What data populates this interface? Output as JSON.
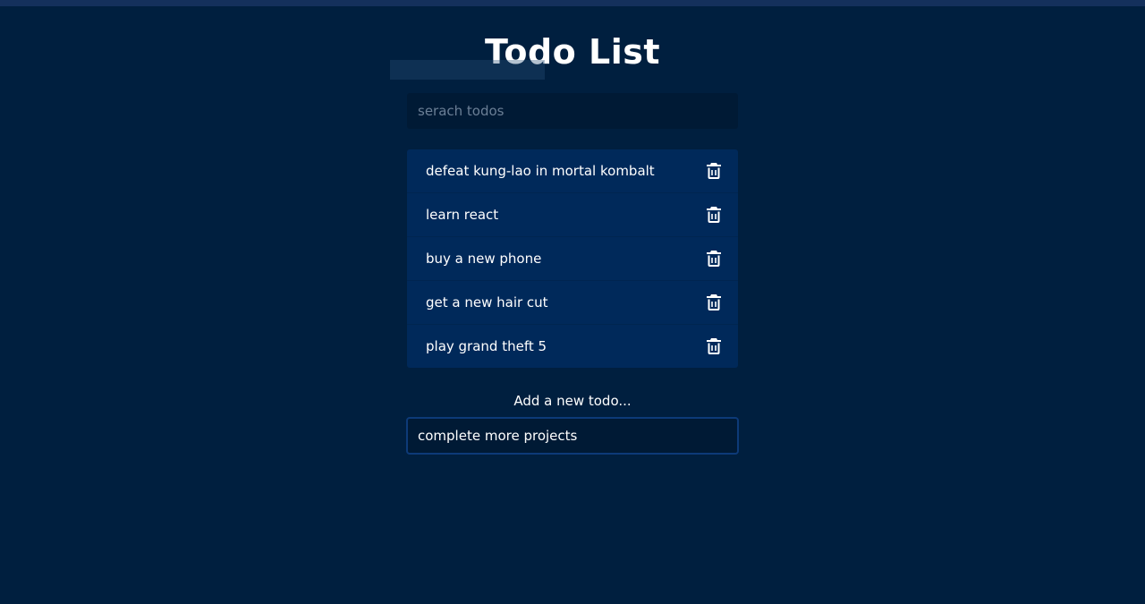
{
  "header": {
    "title": "Todo List"
  },
  "search": {
    "placeholder": "serach todos",
    "value": ""
  },
  "todos": [
    {
      "text": "defeat kung-lao in mortal kombalt",
      "icon": "trash-icon"
    },
    {
      "text": "learn react",
      "icon": "trash-icon"
    },
    {
      "text": "buy a new phone",
      "icon": "trash-icon"
    },
    {
      "text": "get a new hair cut",
      "icon": "trash-icon"
    },
    {
      "text": "play grand theft 5",
      "icon": "trash-icon"
    }
  ],
  "add": {
    "label": "Add a new todo...",
    "value": "complete more projects"
  },
  "colors": {
    "background": "#001f3f",
    "list_background": "#00295a",
    "input_background": "#001a35",
    "focus_border": "#0d3a78",
    "text": "#ffffff"
  }
}
